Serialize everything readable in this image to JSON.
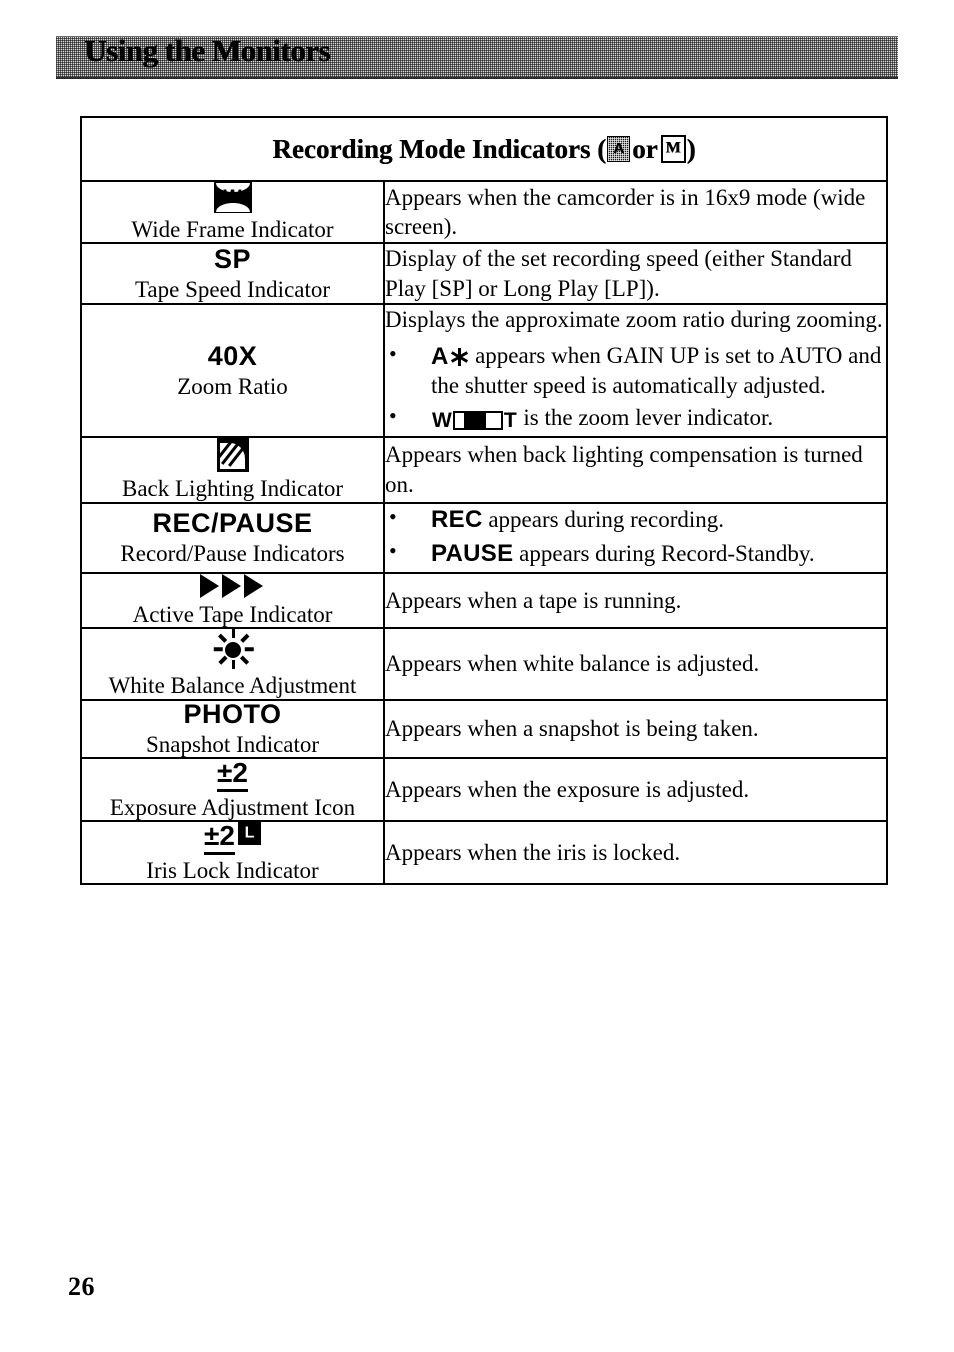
{
  "header": {
    "running_head": "Using the Monitors"
  },
  "table": {
    "title": {
      "prefix": "Recording Mode Indicators (",
      "icon_auto": "A",
      "conjunction": " or ",
      "icon_manual": "M",
      "suffix": ")"
    },
    "rows": [
      {
        "symbol_type": "icon-wide-frame",
        "symbol_text": "W",
        "label": "Wide Frame Indicator",
        "description": "Appears when the camcorder is in 16x9 mode (wide screen).",
        "bullets": []
      },
      {
        "symbol_type": "text",
        "symbol_text": "SP",
        "label": "Tape Speed Indicator",
        "description": "Display of the set recording speed (either Standard Play [SP] or Long Play [LP]).",
        "bullets": []
      },
      {
        "symbol_type": "text",
        "symbol_text": "40X",
        "label": "Zoom Ratio",
        "description": "Displays the approximate zoom ratio during zooming.",
        "bullets": [
          {
            "icon": "gain-up-icon",
            "icon_text": "A",
            "text": " appears when GAIN UP is set to AUTO and the shutter speed is automatically adjusted."
          },
          {
            "icon": "zoom-lever-icon",
            "icon_left": "W",
            "icon_right": "T",
            "text": " is the zoom lever indicator."
          }
        ]
      },
      {
        "symbol_type": "icon-backlight",
        "symbol_text": "",
        "label": "Back Lighting Indicator",
        "description": "Appears when back lighting compensation is turned on.",
        "bullets": []
      },
      {
        "symbol_type": "text",
        "symbol_text": "REC/PAUSE",
        "label": "Record/Pause Indicators",
        "description": "",
        "bullets": [
          {
            "icon": "none",
            "keyword": "REC",
            "text": " appears during recording."
          },
          {
            "icon": "none",
            "keyword": "PAUSE",
            "text": " appears during Record-Standby."
          }
        ]
      },
      {
        "symbol_type": "icon-triangles",
        "symbol_text": "",
        "label": "Active Tape Indicator",
        "description": "Appears when a tape is running.",
        "bullets": []
      },
      {
        "symbol_type": "icon-sun",
        "symbol_text": "",
        "label": "White Balance Adjustment",
        "description": "Appears when white balance is adjusted.",
        "bullets": []
      },
      {
        "symbol_type": "text",
        "symbol_text": "PHOTO",
        "label": "Snapshot Indicator",
        "description": "Appears when a snapshot is being taken.",
        "bullets": []
      },
      {
        "symbol_type": "exposure",
        "symbol_text": "±2",
        "label": "Exposure Adjustment Icon",
        "description": "Appears when the exposure is adjusted.",
        "bullets": []
      },
      {
        "symbol_type": "iris-lock",
        "symbol_text": "±2",
        "symbol_lock": "L",
        "label": "Iris Lock Indicator",
        "description": "Appears when the iris is locked.",
        "bullets": []
      }
    ]
  },
  "footer": {
    "page_number": "26"
  }
}
